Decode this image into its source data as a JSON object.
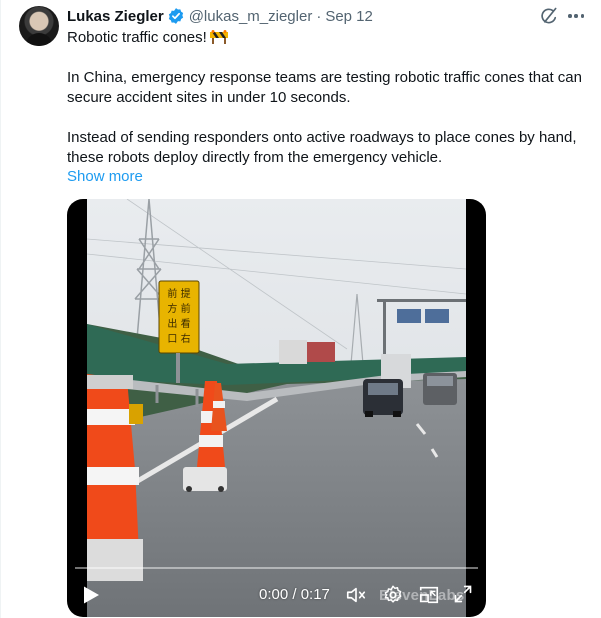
{
  "author": {
    "name": "Lukas Ziegler",
    "handle": "@lukas_m_ziegler",
    "separator": "·",
    "date": "Sep 12",
    "verified": true,
    "verified_color": "#1d9bf0"
  },
  "icons": {
    "grok": "grok-icon",
    "more": "more-icon",
    "barrier_emoji": "construction-barrier-emoji"
  },
  "tweet": {
    "line1": "Robotic traffic cones!",
    "paragraph2": "In China, emergency response teams are testing robotic traffic cones that can secure accident sites in under 10 seconds.",
    "paragraph3": "Instead of sending responders onto active roadways to place cones by hand, these robots deploy directly from the emergency vehicle.",
    "show_more": "Show more"
  },
  "video": {
    "sign_text": "前方出口 提前右看",
    "timestamp": "0:00 / 0:17",
    "progress": 0,
    "watermark": "ElevenLabs"
  },
  "colors": {
    "text": "#0f1419",
    "secondary": "#536471",
    "link": "#1d9bf0"
  }
}
